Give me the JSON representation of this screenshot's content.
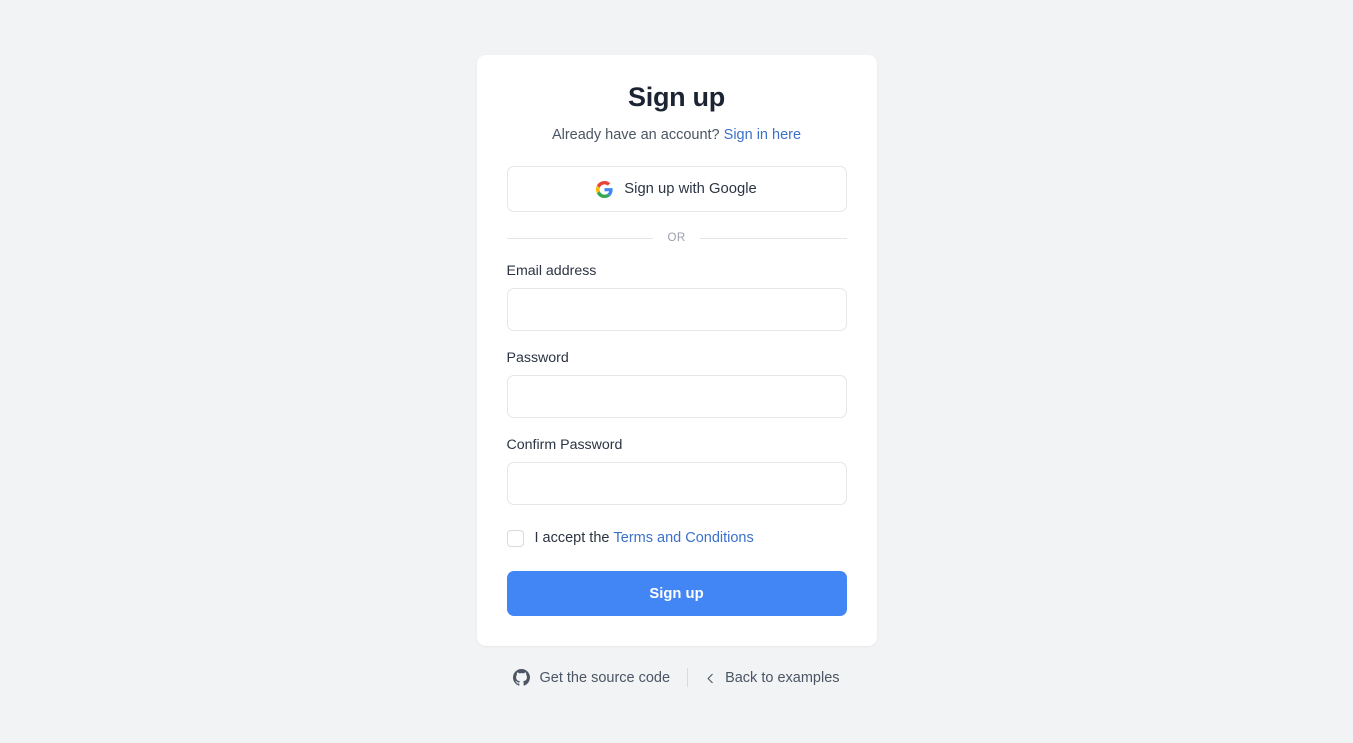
{
  "card": {
    "title": "Sign up",
    "already_text": "Already have an account?",
    "signin_link": "Sign in here",
    "google_button": "Sign up with Google",
    "divider_text": "OR",
    "fields": [
      {
        "label": "Email address",
        "value": "",
        "placeholder": "",
        "type": "email",
        "name": "email"
      },
      {
        "label": "Password",
        "value": "",
        "placeholder": "",
        "type": "password",
        "name": "password"
      },
      {
        "label": "Confirm Password",
        "value": "",
        "placeholder": "",
        "type": "password",
        "name": "confirm-password"
      }
    ],
    "terms": {
      "accept_text": "I accept the",
      "terms_link": "Terms and Conditions",
      "checked": false
    },
    "submit_label": "Sign up"
  },
  "footer": {
    "source_code_label": "Get the source code",
    "back_label": "Back to examples"
  },
  "colors": {
    "page_background": "#f2f3f5",
    "card_background": "#ffffff",
    "accent_blue": "#4285f4",
    "link_blue": "#3b71ca",
    "text_primary": "#1c2434",
    "text_secondary": "#4b5563",
    "border": "#e4e6ea",
    "google_blue": "#4285f4",
    "google_red": "#ea4335",
    "google_yellow": "#fbbc05",
    "google_green": "#34a853"
  }
}
